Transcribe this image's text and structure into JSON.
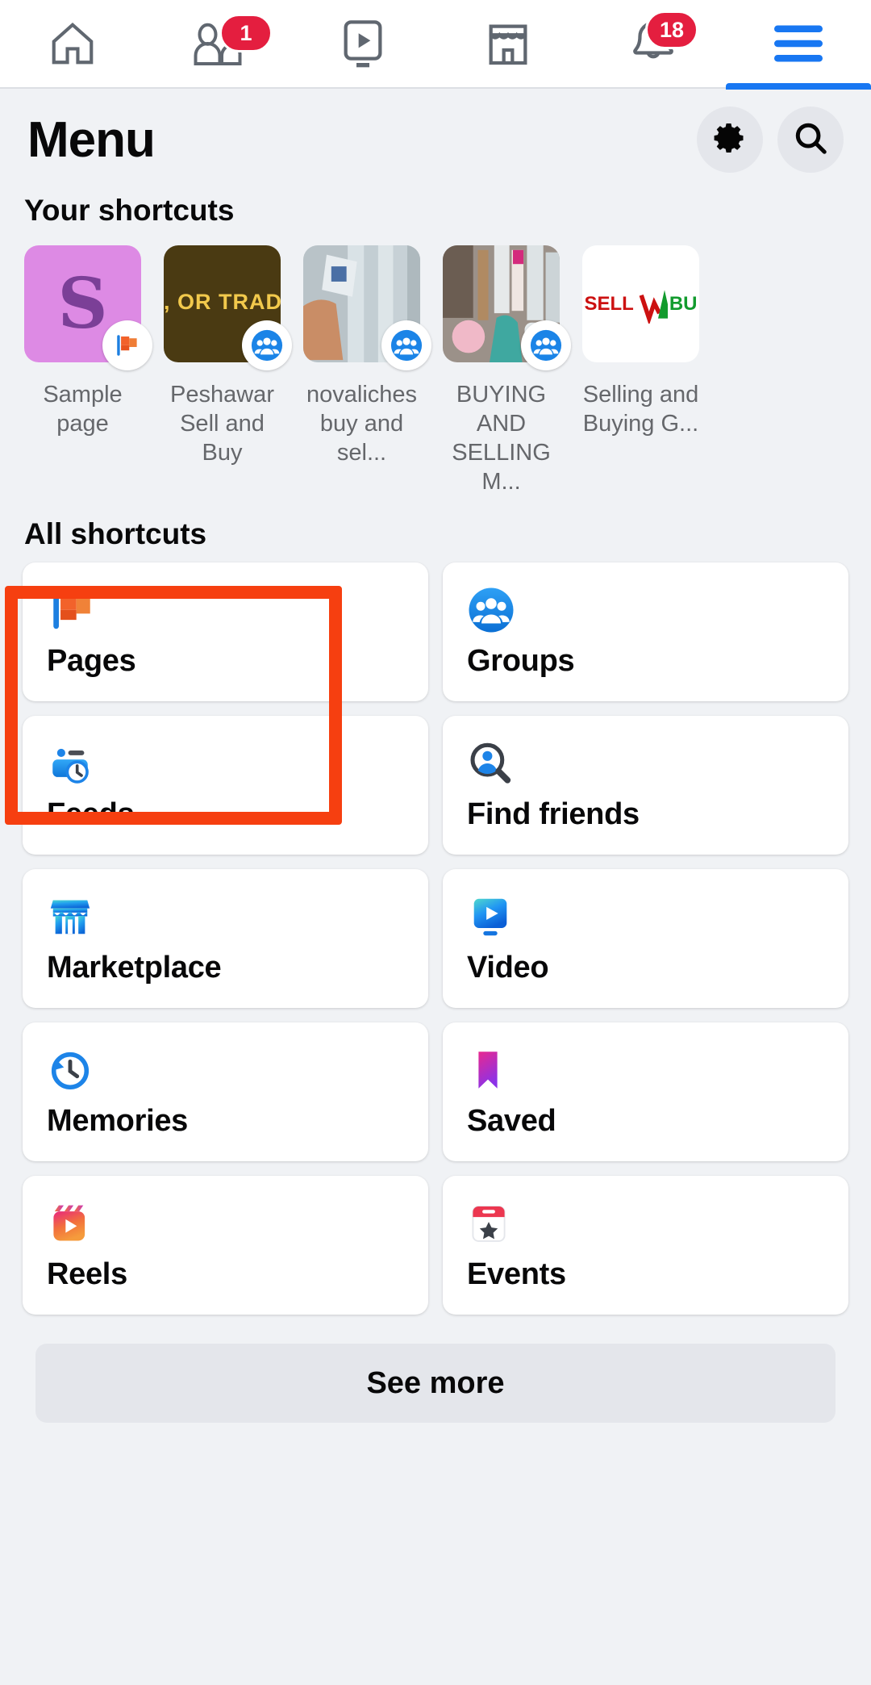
{
  "topnav": {
    "items": [
      {
        "name": "home-icon",
        "label": "Home",
        "badge": null
      },
      {
        "name": "friends-icon",
        "label": "Friends",
        "badge": "1"
      },
      {
        "name": "video-icon",
        "label": "Video",
        "badge": null
      },
      {
        "name": "marketplace-icon",
        "label": "Marketplace",
        "badge": null
      },
      {
        "name": "notifications-bell-icon",
        "label": "Notifications",
        "badge": "18"
      },
      {
        "name": "menu-hamburger-icon",
        "label": "Menu",
        "badge": null,
        "active": true
      }
    ]
  },
  "header": {
    "title": "Menu",
    "settings_label": "Settings",
    "search_label": "Search"
  },
  "shortcuts_section": {
    "title": "Your shortcuts",
    "items": [
      {
        "label": "Sample page",
        "badge": "page-flag-badge",
        "tile": "letter",
        "letter": "S",
        "tile_color": "#dd8ae4"
      },
      {
        "label": "Peshawar Sell and Buy",
        "badge": "group-people-badge",
        "tile": "gold",
        "gold_text": ", OR TRADE",
        "tile_color": "#4a3a12"
      },
      {
        "label": "novaliches buy and sel...",
        "badge": "group-people-badge",
        "tile": "photo-money",
        "tile_color": "#9aa7ae"
      },
      {
        "label": "BUYING AND SELLING M...",
        "badge": "group-people-badge",
        "tile": "photo-bottles",
        "tile_color": "#a39a93"
      },
      {
        "label": "Selling and Buying G...",
        "badge": "group-people-badge",
        "tile": "sellbuy",
        "sell_text": "SELL",
        "buy_text": "BU",
        "tile_color": "#ffffff"
      }
    ]
  },
  "all_shortcuts_section": {
    "title": "All shortcuts",
    "cards": [
      {
        "label": "Pages",
        "icon": "pages-flag-icon",
        "highlighted": true
      },
      {
        "label": "Groups",
        "icon": "groups-people-icon",
        "highlighted": false
      },
      {
        "label": "Feeds",
        "icon": "feeds-clock-icon",
        "highlighted": false
      },
      {
        "label": "Find friends",
        "icon": "find-friends-search-icon",
        "highlighted": false
      },
      {
        "label": "Marketplace",
        "icon": "marketplace-store-icon",
        "highlighted": false
      },
      {
        "label": "Video",
        "icon": "video-play-icon",
        "highlighted": false
      },
      {
        "label": "Memories",
        "icon": "memories-clock-icon",
        "highlighted": false
      },
      {
        "label": "Saved",
        "icon": "saved-bookmark-icon",
        "highlighted": false
      },
      {
        "label": "Reels",
        "icon": "reels-clapper-icon",
        "highlighted": false
      },
      {
        "label": "Events",
        "icon": "events-calendar-icon",
        "highlighted": false
      }
    ]
  },
  "footer": {
    "see_more_label": "See more"
  },
  "colors": {
    "background": "#f0f2f5",
    "card": "#ffffff",
    "accent_blue": "#1877f2",
    "badge_red": "#e41e3f",
    "highlight_red": "#f63f10",
    "text_primary": "#080809",
    "text_secondary": "#65676b"
  }
}
